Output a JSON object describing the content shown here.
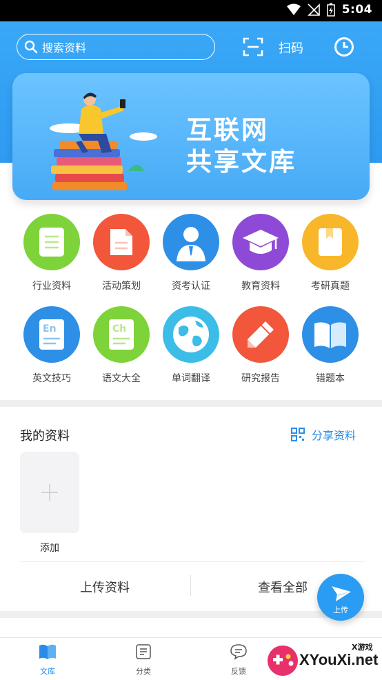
{
  "status_bar": {
    "time": "5:04"
  },
  "header": {
    "search_placeholder": "搜索资料",
    "scan_label": "扫码"
  },
  "banner": {
    "title_line1": "互联网",
    "title_line2": "共享文库"
  },
  "categories": [
    {
      "label": "行业资料",
      "icon": "document-icon",
      "color": "#7ed23a"
    },
    {
      "label": "活动策划",
      "icon": "file-icon",
      "color": "#f2563b"
    },
    {
      "label": "资考认证",
      "icon": "person-icon",
      "color": "#2e8fe6"
    },
    {
      "label": "教育资料",
      "icon": "graduation-cap-icon",
      "color": "#8e4ad6"
    },
    {
      "label": "考研真题",
      "icon": "bookmark-book-icon",
      "color": "#f8b72a"
    },
    {
      "label": "英文技巧",
      "icon": "english-doc-icon",
      "color": "#2e8fe6"
    },
    {
      "label": "语文大全",
      "icon": "chinese-doc-icon",
      "color": "#7ed23a"
    },
    {
      "label": "单词翻译",
      "icon": "globe-icon",
      "color": "#3cbde8"
    },
    {
      "label": "研究报告",
      "icon": "pencil-icon",
      "color": "#f2563b"
    },
    {
      "label": "错题本",
      "icon": "open-book-icon",
      "color": "#2e8fe6"
    }
  ],
  "my_materials": {
    "title": "我的资料",
    "share_label": "分享资料",
    "add_label": "添加",
    "upload_label": "上传资料",
    "view_all_label": "查看全部"
  },
  "fab": {
    "label": "上传"
  },
  "tabbar": {
    "tabs": [
      {
        "label": "文库",
        "icon": "library-icon",
        "active": true
      },
      {
        "label": "分类",
        "icon": "category-list-icon",
        "active": false
      },
      {
        "label": "反馈",
        "icon": "feedback-bubble-icon",
        "active": false
      }
    ]
  },
  "watermark": {
    "text": "XYouXi.net",
    "small": "X游戏"
  },
  "colors": {
    "primary": "#2e9af2",
    "accent_text": "#2a8ce8"
  }
}
